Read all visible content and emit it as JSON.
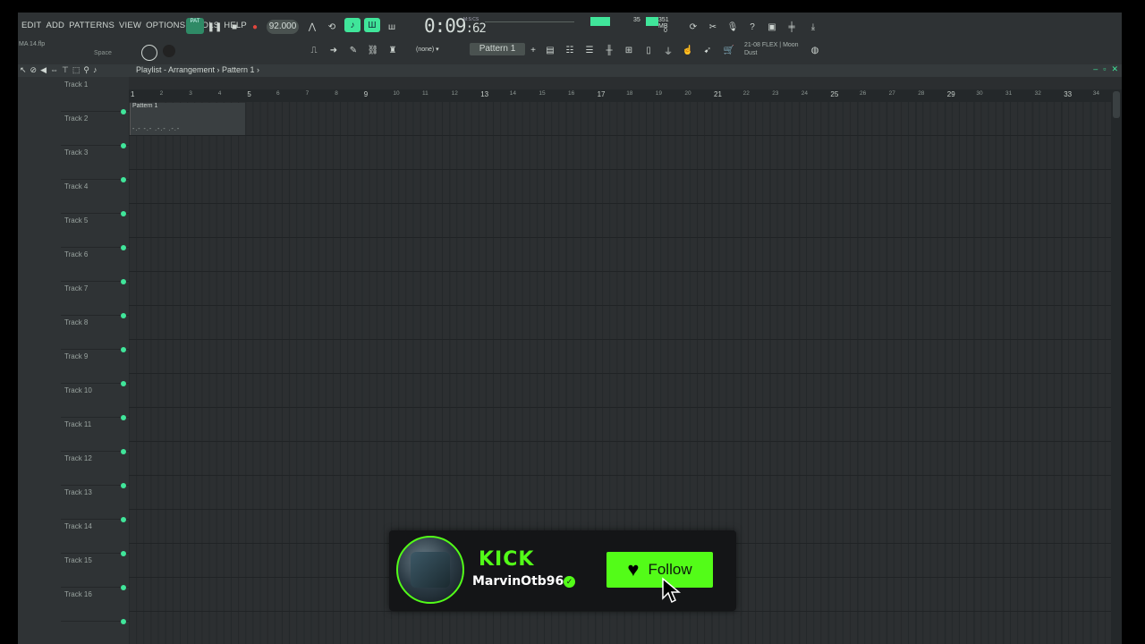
{
  "menu": [
    "EDIT",
    "ADD",
    "PATTERNS",
    "VIEW",
    "OPTIONS",
    "TOOLS",
    "HELP"
  ],
  "project_file": "MA 14.flp",
  "space_label": "Space",
  "pat_label": "PAT",
  "tempo": "92.000",
  "time_display": {
    "main": "0:09",
    "sub": ":62",
    "label": "M:S:CS"
  },
  "cpu_values": {
    "cpu": "35",
    "mem": "351 MB",
    "poly": "0"
  },
  "pattern_select": "Pattern 1",
  "plugin_select": "(none)",
  "news": {
    "line1": "21-08  FLEX | Moon",
    "line2": "Dust"
  },
  "playlist_title": "Playlist - Arrangement › Pattern 1 ›",
  "ruler_numbers": [
    "1",
    "2",
    "3",
    "4",
    "5",
    "6",
    "7",
    "8",
    "9",
    "10",
    "11",
    "12",
    "13",
    "14",
    "15",
    "16",
    "17",
    "18",
    "19",
    "20",
    "21",
    "22",
    "23",
    "24",
    "25",
    "26",
    "27",
    "28",
    "29",
    "30",
    "31",
    "32",
    "33",
    "34"
  ],
  "tracks": [
    "Track 1",
    "Track 2",
    "Track 3",
    "Track 4",
    "Track 5",
    "Track 6",
    "Track 7",
    "Track 8",
    "Track 9",
    "Track 10",
    "Track 11",
    "Track 12",
    "Track 13",
    "Track 14",
    "Track 15",
    "Track 16"
  ],
  "clip": {
    "name": "Pattern 1"
  },
  "overlay": {
    "brand": "KICK",
    "username": "MarvinOtb96",
    "follow_label": "Follow",
    "accent": "#53fc18"
  },
  "colors": {
    "accent": "#40e59a",
    "bg": "#2b2e30"
  }
}
